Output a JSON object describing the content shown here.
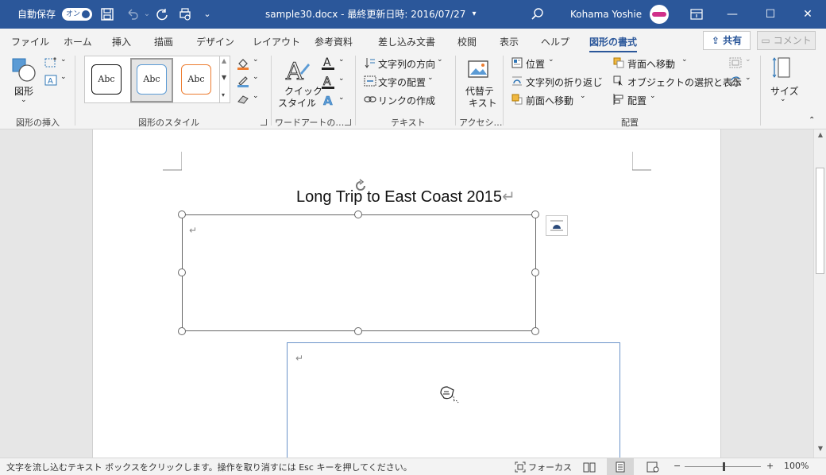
{
  "titlebar": {
    "autosave_label": "自動保存",
    "autosave_state": "オン",
    "document_title": "sample30.docx - 最終更新日時: 2016/07/27",
    "user_name": "Kohama Yoshie"
  },
  "tabs": [
    {
      "label": "ファイル"
    },
    {
      "label": "ホーム"
    },
    {
      "label": "挿入"
    },
    {
      "label": "描画"
    },
    {
      "label": "デザイン"
    },
    {
      "label": "レイアウト"
    },
    {
      "label": "参考資料"
    },
    {
      "label": "差し込み文書"
    },
    {
      "label": "校閲"
    },
    {
      "label": "表示"
    },
    {
      "label": "ヘルプ"
    },
    {
      "label": "図形の書式",
      "active": true
    }
  ],
  "share_label": "共有",
  "comment_label": "コメント",
  "ribbon": {
    "insert_shapes": {
      "shapes_label": "図形",
      "group_label": "図形の挿入"
    },
    "shape_styles": {
      "samples": [
        "Abc",
        "Abc",
        "Abc"
      ],
      "group_label": "図形のスタイル"
    },
    "wordart": {
      "quick_styles_label_1": "クイック",
      "quick_styles_label_2": "スタイル",
      "group_label": "ワードアートの…"
    },
    "text": {
      "direction_label": "文字列の方向",
      "align_label": "文字の配置",
      "link_label": "リンクの作成",
      "group_label": "テキスト"
    },
    "accessibility": {
      "alt_text_label_1": "代替テ",
      "alt_text_label_2": "キスト",
      "group_label": "アクセシ…"
    },
    "arrange": {
      "position_label": "位置",
      "wrap_label": "文字列の折り返し",
      "bring_forward_label": "前面へ移動",
      "send_backward_label": "背面へ移動",
      "selection_pane_label": "オブジェクトの選択と表示",
      "align_label": "配置",
      "group_label": "配置"
    },
    "size": {
      "label": "サイズ"
    }
  },
  "document": {
    "title_text": "Long Trip to East Coast 2015",
    "paragraph_mark": "↵"
  },
  "statusbar": {
    "message": "文字を流し込むテキスト ボックスをクリックします。操作を取り消すには Esc キーを押してください。",
    "focus_label": "フォーカス",
    "zoom_minus": "−",
    "zoom_plus": "+",
    "zoom_level": "100%"
  },
  "colors": {
    "accent": "#2b579a",
    "style_blue": "#5b9bd5",
    "style_orange": "#ed7d31"
  }
}
